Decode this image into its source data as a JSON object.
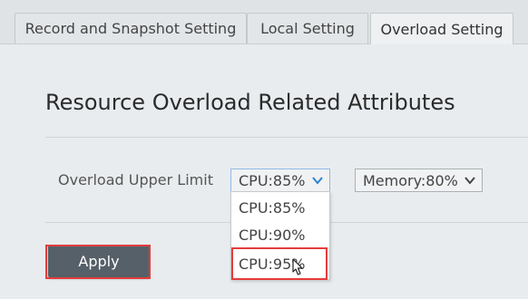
{
  "tabs": [
    {
      "label": "Record and Snapshot Setting",
      "active": false
    },
    {
      "label": "Local Setting",
      "active": false
    },
    {
      "label": "Overload Setting",
      "active": true
    }
  ],
  "section": {
    "title": "Resource Overload Related Attributes"
  },
  "overload": {
    "label": "Overload Upper Limit",
    "cpu_select": {
      "value": "CPU:85%",
      "icon": "chevron-down-icon"
    },
    "memory_select": {
      "value": "Memory:80%",
      "icon": "chevron-down-icon"
    },
    "cpu_options": [
      "CPU:85%",
      "CPU:90%",
      "CPU:95%"
    ],
    "highlighted_option": "CPU:95%"
  },
  "apply_button": {
    "label": "Apply"
  },
  "colors": {
    "accent": "#2a7fd4",
    "highlight": "#e53c3c",
    "button": "#566068"
  }
}
